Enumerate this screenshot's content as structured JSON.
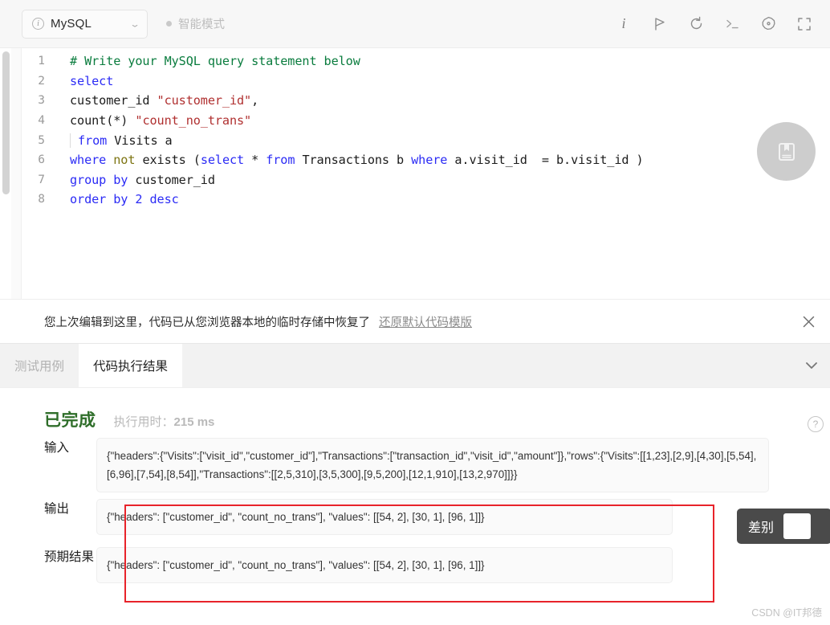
{
  "toolbar": {
    "language": "MySQL",
    "info_icon": "info-circle-icon",
    "dropdown_icon": "chevron-down-icon",
    "smart_mode_label": "智能模式",
    "icons": [
      {
        "name": "info-icon",
        "glyph": "i"
      },
      {
        "name": "run-flag-icon",
        "glyph": "flag"
      },
      {
        "name": "reset-undo-icon",
        "glyph": "undo"
      },
      {
        "name": "console-terminal-icon",
        "glyph": "terminal"
      },
      {
        "name": "settings-gear-icon",
        "glyph": "gear"
      },
      {
        "name": "fullscreen-icon",
        "glyph": "expand"
      }
    ]
  },
  "editor": {
    "save_fab_icon": "bookmark-book-icon",
    "lines": [
      {
        "n": "1",
        "tokens": [
          {
            "t": "# Write your MySQL query statement below",
            "c": "k-cmt"
          }
        ]
      },
      {
        "n": "2",
        "tokens": [
          {
            "t": "select",
            "c": "k-kw"
          }
        ]
      },
      {
        "n": "3",
        "tokens": [
          {
            "t": "customer_id ",
            "c": "k-pl"
          },
          {
            "t": "\"customer_id\"",
            "c": "k-str"
          },
          {
            "t": ",",
            "c": "k-pl"
          }
        ]
      },
      {
        "n": "4",
        "tokens": [
          {
            "t": "count(*) ",
            "c": "k-pl"
          },
          {
            "t": "\"count_no_trans\"",
            "c": "k-str"
          }
        ]
      },
      {
        "n": "5",
        "guide": true,
        "tokens": [
          {
            "t": "from",
            "c": "k-kw"
          },
          {
            "t": " Visits a",
            "c": "k-pl"
          }
        ]
      },
      {
        "n": "6",
        "tokens": [
          {
            "t": "where",
            "c": "k-kw"
          },
          {
            "t": " ",
            "c": "k-pl"
          },
          {
            "t": "not",
            "c": "k-op"
          },
          {
            "t": " exists (",
            "c": "k-pl"
          },
          {
            "t": "select",
            "c": "k-kw"
          },
          {
            "t": " * ",
            "c": "k-pl"
          },
          {
            "t": "from",
            "c": "k-kw"
          },
          {
            "t": " Transactions b ",
            "c": "k-pl"
          },
          {
            "t": "where",
            "c": "k-kw"
          },
          {
            "t": " a.visit_id  = b.visit_id )",
            "c": "k-pl"
          }
        ]
      },
      {
        "n": "7",
        "tokens": [
          {
            "t": "group",
            "c": "k-kw"
          },
          {
            "t": " ",
            "c": "k-pl"
          },
          {
            "t": "by",
            "c": "k-kw"
          },
          {
            "t": " customer_id",
            "c": "k-pl"
          }
        ]
      },
      {
        "n": "8",
        "tokens": [
          {
            "t": "order",
            "c": "k-kw"
          },
          {
            "t": " ",
            "c": "k-pl"
          },
          {
            "t": "by",
            "c": "k-kw"
          },
          {
            "t": " ",
            "c": "k-pl"
          },
          {
            "t": "2",
            "c": "k-num"
          },
          {
            "t": " ",
            "c": "k-pl"
          },
          {
            "t": "desc",
            "c": "k-kw"
          }
        ]
      }
    ]
  },
  "notice": {
    "message": "您上次编辑到这里，代码已从您浏览器本地的临时存储中恢复了",
    "link": "还原默认代码模版",
    "close_icon": "close-x-icon"
  },
  "tabs": {
    "testcase_label": "测试用例",
    "result_label": "代码执行结果",
    "collapse_icon": "chevron-down-icon"
  },
  "result": {
    "status": "已完成",
    "runtime_prefix": "执行用时：",
    "runtime_value": "215 ms",
    "help_icon": "question-mark-icon",
    "input_label": "输入",
    "input_value": "{\"headers\":{\"Visits\":[\"visit_id\",\"customer_id\"],\"Transactions\":[\"transaction_id\",\"visit_id\",\"amount\"]},\"rows\":{\"Visits\":[[1,23],[2,9],[4,30],[5,54],[6,96],[7,54],[8,54]],\"Transactions\":[[2,5,310],[3,5,300],[9,5,200],[12,1,910],[13,2,970]]}}",
    "output_label": "输出",
    "output_value": "{\"headers\": [\"customer_id\", \"count_no_trans\"], \"values\": [[54, 2], [30, 1], [96, 1]]}",
    "expected_label": "预期结果",
    "expected_value": "{\"headers\": [\"customer_id\", \"count_no_trans\"], \"values\": [[54, 2], [30, 1], [96, 1]]}",
    "diff_label": "差别"
  },
  "watermark": "CSDN @IT邦德",
  "colors": {
    "status_green": "#2f6e2a",
    "annotation_red": "#e8232a",
    "keyword_blue": "#2b2bf5",
    "comment_green": "#0a7c3e",
    "string_red": "#b03030"
  }
}
